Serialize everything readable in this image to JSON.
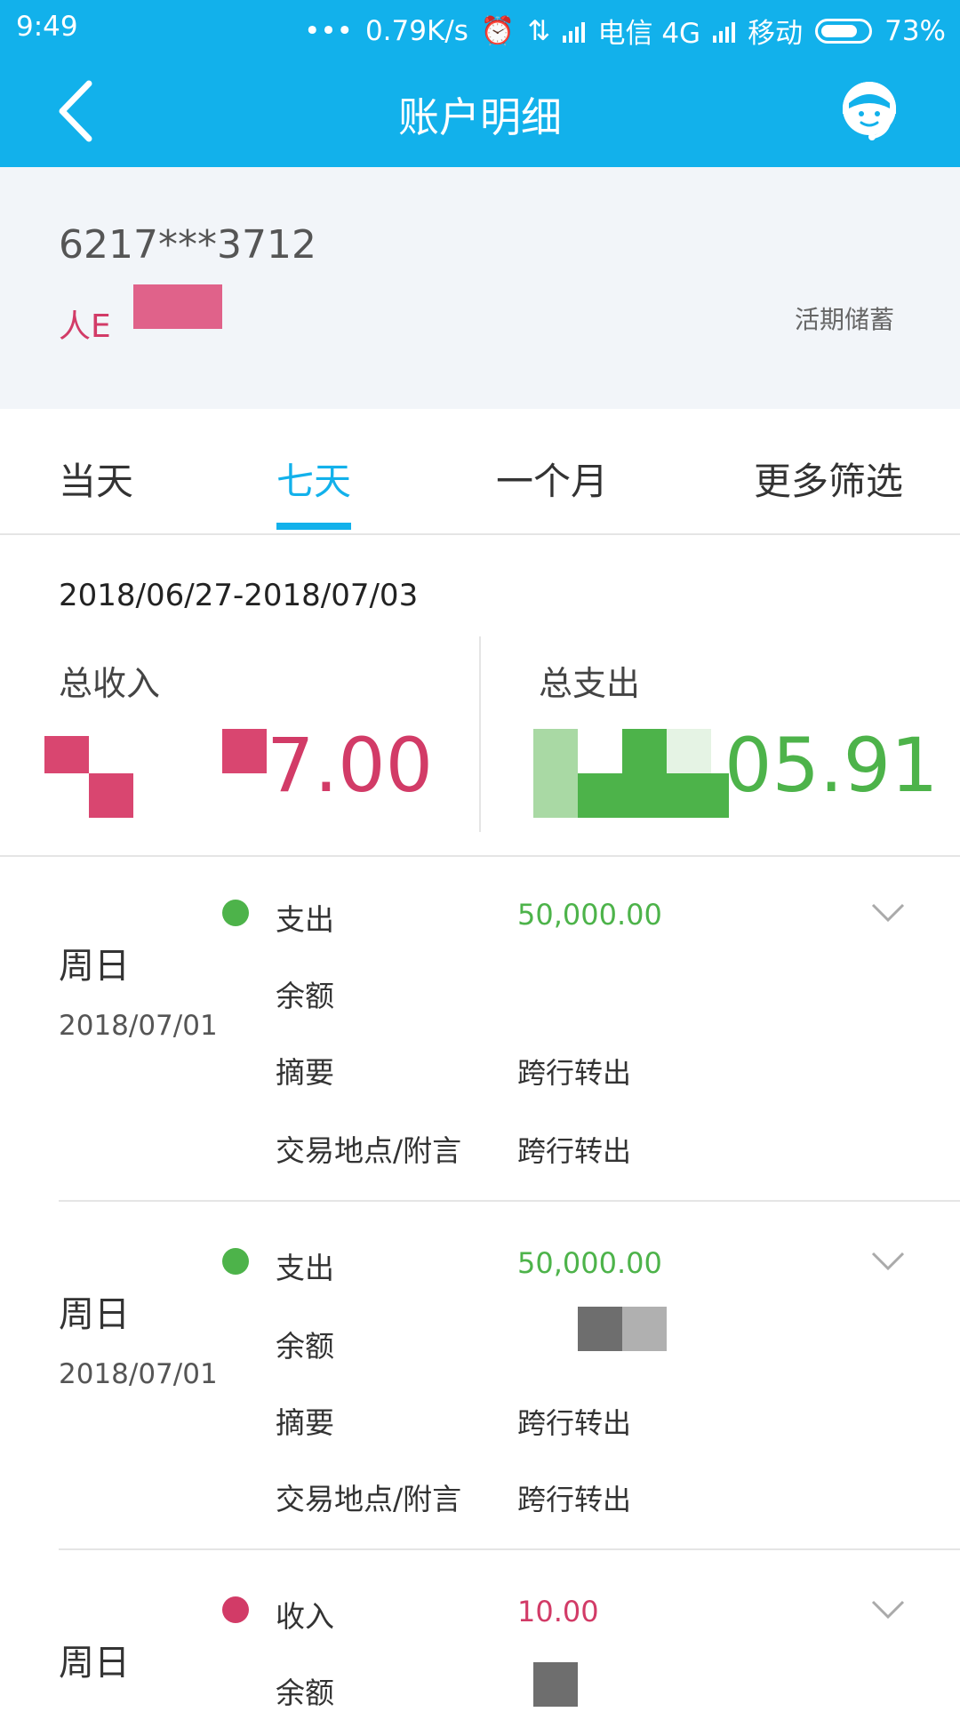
{
  "status_bar": {
    "time": "9:49",
    "dots": "•••",
    "speed": "0.79K/s",
    "carrier1": "电信 4G",
    "carrier2": "移动",
    "battery": "73%"
  },
  "header": {
    "title": "账户明细"
  },
  "account": {
    "number": "6217***3712",
    "currency_partial": "人E",
    "type": "活期储蓄"
  },
  "tabs": [
    {
      "label": "当天",
      "active": false
    },
    {
      "label": "七天",
      "active": true
    },
    {
      "label": "一个月",
      "active": false
    },
    {
      "label": "更多筛选",
      "active": false
    }
  ],
  "summary": {
    "date_range": "2018/06/27-2018/07/03",
    "income_label": "总收入",
    "income_value_visible": "7.00",
    "expense_label": "总支出",
    "expense_value_visible": "05.91"
  },
  "transactions": [
    {
      "weekday": "周日",
      "date": "2018/07/01",
      "type": "支出",
      "direction": "out",
      "amount": "50,000.00",
      "balance_label": "余额",
      "summary_label": "摘要",
      "summary": "跨行转出",
      "place_label": "交易地点/附言",
      "place": "跨行转出"
    },
    {
      "weekday": "周日",
      "date": "2018/07/01",
      "type": "支出",
      "direction": "out",
      "amount": "50,000.00",
      "balance_label": "余额",
      "summary_label": "摘要",
      "summary": "跨行转出",
      "place_label": "交易地点/附言",
      "place": "跨行转出"
    },
    {
      "weekday": "周日",
      "type": "收入",
      "direction": "in",
      "amount": "10.00",
      "balance_label": "余额"
    }
  ],
  "colors": {
    "brand": "#12b1eb",
    "income": "#d23b67",
    "expense": "#4db34a"
  },
  "icons": {
    "back": "chevron-left-icon",
    "service": "customer-service-icon",
    "expand": "chevron-down-icon"
  }
}
